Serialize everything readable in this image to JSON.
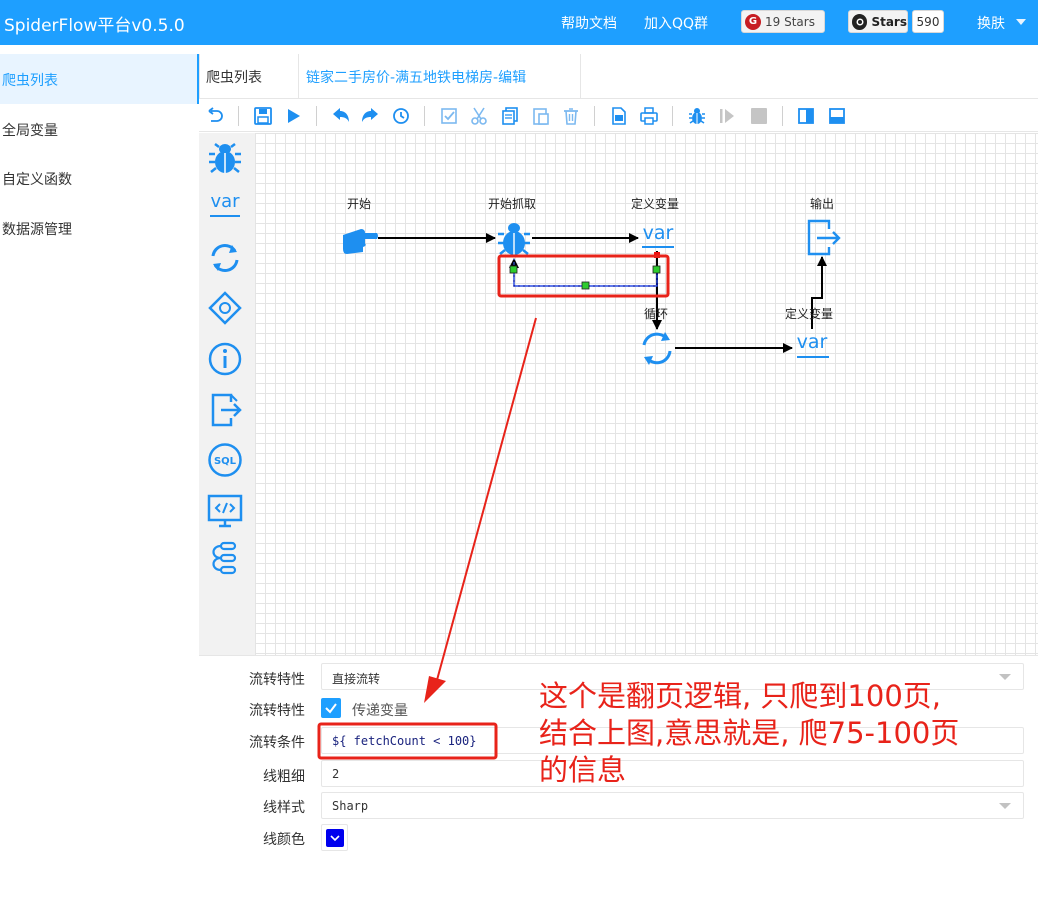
{
  "header": {
    "brand": "SpiderFlow平台v0.5.0",
    "links": [
      "帮助文档",
      "加入QQ群"
    ],
    "gitee_badge": "19 Stars",
    "github_badge": "Stars",
    "github_count": "590",
    "skin": "换肤"
  },
  "sidebar": {
    "items": [
      {
        "label": "爬虫列表"
      },
      {
        "label": "全局变量"
      },
      {
        "label": "自定义函数"
      },
      {
        "label": "数据源管理"
      }
    ]
  },
  "tabs": [
    {
      "label": "爬虫列表"
    },
    {
      "label": "链家二手房价-满五地铁电梯房-编辑"
    }
  ],
  "toolbar": {
    "icons": [
      "undo-icon",
      "save-icon",
      "run-icon",
      "undo-arrow-icon",
      "redo-arrow-icon",
      "history-icon",
      "select-all-icon",
      "cut-icon",
      "copy-icon",
      "paste-icon",
      "delete-icon",
      "export-image-icon",
      "print-icon",
      "debug-icon",
      "resume-icon",
      "stop-icon",
      "panel-right-icon",
      "panel-bottom-icon"
    ]
  },
  "palette": {
    "items": [
      {
        "icon": "spider-icon",
        "text": ""
      },
      {
        "icon": "variable-icon",
        "text": "var"
      },
      {
        "icon": "loop-icon",
        "text": ""
      },
      {
        "icon": "condition-icon",
        "text": ""
      },
      {
        "icon": "info-icon",
        "text": ""
      },
      {
        "icon": "output-icon",
        "text": ""
      },
      {
        "icon": "sql-icon",
        "text": "SQL"
      },
      {
        "icon": "code-icon",
        "text": ""
      },
      {
        "icon": "process-icon",
        "text": ""
      }
    ]
  },
  "canvas": {
    "nodes": [
      {
        "label": "开始",
        "icon": "hand-pointer-icon"
      },
      {
        "label": "开始抓取",
        "icon": "spider-icon"
      },
      {
        "label": "定义变量",
        "icon": "variable-icon",
        "text": "var"
      },
      {
        "label": "输出",
        "icon": "output-icon"
      },
      {
        "label": "循环",
        "icon": "loop-icon"
      },
      {
        "label": "定义变量",
        "icon": "variable-icon",
        "text": "var"
      }
    ]
  },
  "properties": {
    "transition_label": "流转特性",
    "transition_value": "直接流转",
    "pass_var_label": "流转特性",
    "pass_var_text": "传递变量",
    "condition_label": "流转条件",
    "condition_value": "${ fetchCount < 100}",
    "line_width_label": "线粗细",
    "line_width_value": "2",
    "line_style_label": "线样式",
    "line_style_value": "Sharp",
    "line_color_label": "线颜色",
    "line_color_value": "#0000ee"
  },
  "annotation": {
    "lines": [
      "这个是翻页逻辑, 只爬到100页,",
      "结合上图,意思就是, 爬75-100页",
      "的信息"
    ],
    "color": "#e8231a"
  },
  "colors": {
    "accent": "#1e9fff",
    "icon_blue": "#1e8ff0",
    "annotation_red": "#e8231a"
  }
}
